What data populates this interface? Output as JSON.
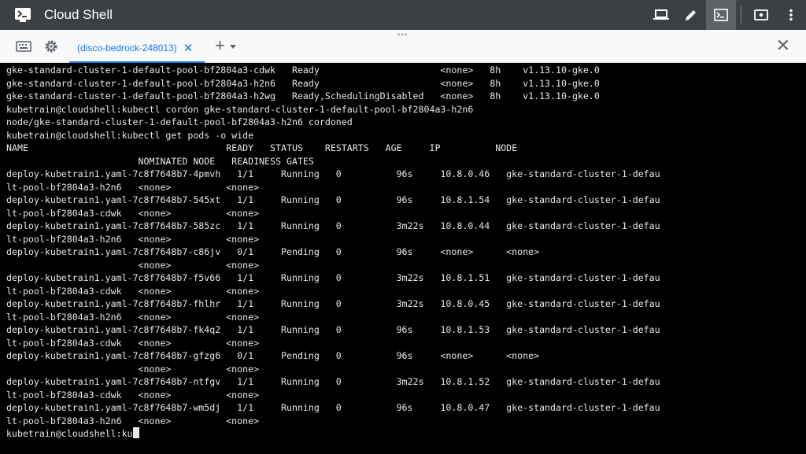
{
  "app": {
    "title": "Cloud Shell"
  },
  "tab": {
    "label": "(disco-bedrock-248013)"
  },
  "terminal": {
    "lines": [
      "gke-standard-cluster-1-default-pool-bf2804a3-cdwk   Ready                      <none>   8h    v1.13.10-gke.0",
      "gke-standard-cluster-1-default-pool-bf2804a3-h2n6   Ready                      <none>   8h    v1.13.10-gke.0",
      "gke-standard-cluster-1-default-pool-bf2804a3-h2wg   Ready,SchedulingDisabled   <none>   8h    v1.13.10-gke.0",
      "kubetrain@cloudshell:kubectl cordon gke-standard-cluster-1-default-pool-bf2804a3-h2n6",
      "node/gke-standard-cluster-1-default-pool-bf2804a3-h2n6 cordoned",
      "kubetrain@cloudshell:kubectl get pods -o wide",
      "NAME                                    READY   STATUS    RESTARTS   AGE     IP          NODE",
      "                        NOMINATED NODE   READINESS GATES",
      "deploy-kubetrain1.yaml-7c8f7648b7-4pmvh   1/1     Running   0          96s     10.8.0.46   gke-standard-cluster-1-defau",
      "lt-pool-bf2804a3-h2n6   <none>          <none>",
      "deploy-kubetrain1.yaml-7c8f7648b7-545xt   1/1     Running   0          96s     10.8.1.54   gke-standard-cluster-1-defau",
      "lt-pool-bf2804a3-cdwk   <none>          <none>",
      "deploy-kubetrain1.yaml-7c8f7648b7-585zc   1/1     Running   0          3m22s   10.8.0.44   gke-standard-cluster-1-defau",
      "lt-pool-bf2804a3-h2n6   <none>          <none>",
      "deploy-kubetrain1.yaml-7c8f7648b7-c86jv   0/1     Pending   0          96s     <none>      <none>",
      "                        <none>          <none>",
      "deploy-kubetrain1.yaml-7c8f7648b7-f5v66   1/1     Running   0          3m22s   10.8.1.51   gke-standard-cluster-1-defau",
      "lt-pool-bf2804a3-cdwk   <none>          <none>",
      "deploy-kubetrain1.yaml-7c8f7648b7-fhlhr   1/1     Running   0          3m22s   10.8.0.45   gke-standard-cluster-1-defau",
      "lt-pool-bf2804a3-h2n6   <none>          <none>",
      "deploy-kubetrain1.yaml-7c8f7648b7-fk4q2   1/1     Running   0          96s     10.8.1.53   gke-standard-cluster-1-defau",
      "lt-pool-bf2804a3-cdwk   <none>          <none>",
      "deploy-kubetrain1.yaml-7c8f7648b7-gfzg6   0/1     Pending   0          96s     <none>      <none>",
      "                        <none>          <none>",
      "deploy-kubetrain1.yaml-7c8f7648b7-ntfgv   1/1     Running   0          3m22s   10.8.1.52   gke-standard-cluster-1-defau",
      "lt-pool-bf2804a3-cdwk   <none>          <none>",
      "deploy-kubetrain1.yaml-7c8f7648b7-wm5dj   1/1     Running   0          96s     10.8.0.47   gke-standard-cluster-1-defau",
      "lt-pool-bf2804a3-h2n6   <none>          <none>"
    ],
    "prompt": "kubetrain@cloudshell:ku"
  }
}
